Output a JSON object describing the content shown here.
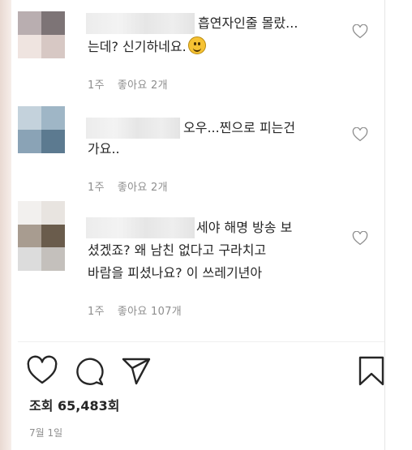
{
  "comments": [
    {
      "line1": "흡연자인줄 몰랐",
      "line1_more": "...",
      "line2": "는데? 신기하네요.",
      "emoji": "smiling-face",
      "age": "1주",
      "likes": "좋아요 2개",
      "avatar_colors": [
        "#b9aeb0",
        "#7d7476",
        "#efe4e0",
        "#d7c8c4"
      ]
    },
    {
      "line1": "오우...찐으로 피는건",
      "line2": "가요..",
      "age": "1주",
      "likes": "좋아요 2개",
      "avatar_colors": [
        "#c4d2dc",
        "#9fb6c6",
        "#8aa3b6",
        "#5c7a90"
      ]
    },
    {
      "line1": "세야 해명 방송 보",
      "line2": "셨겠죠? 왜 남친 없다고 구라치고",
      "line3": "바람을 피셨나요? 이 쓰레기년아",
      "age": "1주",
      "likes": "좋아요 107개",
      "avatar_colors": [
        "#f2f0ee",
        "#e8e4e0",
        "#a89c90",
        "#6a5c4c",
        "#dcdcdc",
        "#c4c0bc"
      ]
    }
  ],
  "actions": {
    "like_icon": "heart-outline-icon",
    "comment_icon": "speech-bubble-icon",
    "share_icon": "paper-plane-icon",
    "save_icon": "bookmark-icon"
  },
  "views": "조회 65,483회",
  "date": "7월 1일",
  "colors": {
    "text": "#262626",
    "muted": "#8e8e8e",
    "divider": "#efefef"
  }
}
